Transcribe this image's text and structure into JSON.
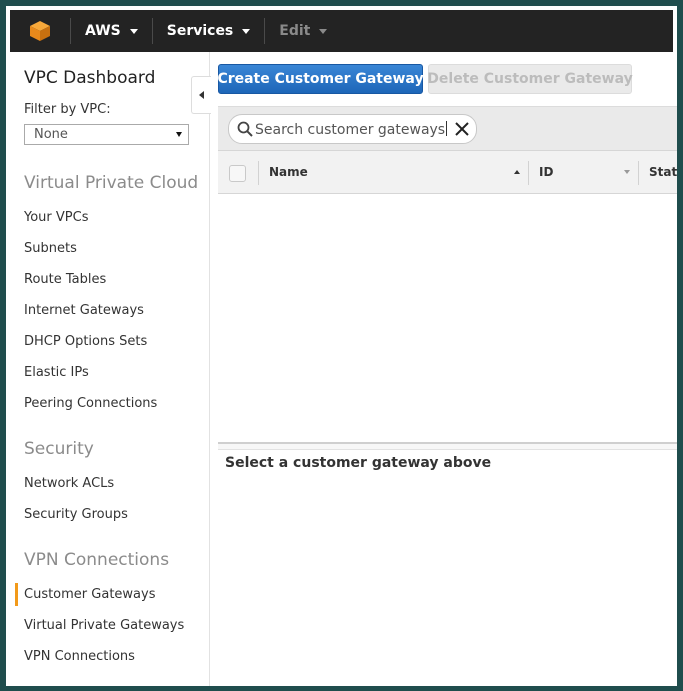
{
  "colors": {
    "nav_bg": "#232323",
    "primary": "#2a74c6",
    "active_indicator": "#f29a1a",
    "section_heading": "#8b8b8b"
  },
  "topnav": {
    "logo_icon": "aws-cube-icon",
    "items": [
      {
        "label": "AWS",
        "has_dropdown": true
      },
      {
        "label": "Services",
        "has_dropdown": true
      },
      {
        "label": "Edit",
        "has_dropdown": true,
        "disabled": true
      }
    ]
  },
  "sidebar": {
    "title": "VPC Dashboard",
    "filter_label": "Filter by VPC:",
    "filter_value": "None",
    "sections": [
      {
        "heading": "Virtual Private Cloud",
        "items": [
          "Your VPCs",
          "Subnets",
          "Route Tables",
          "Internet Gateways",
          "DHCP Options Sets",
          "Elastic IPs",
          "Peering Connections"
        ]
      },
      {
        "heading": "Security",
        "items": [
          "Network ACLs",
          "Security Groups"
        ]
      },
      {
        "heading": "VPN Connections",
        "items": [
          "Customer Gateways",
          "Virtual Private Gateways",
          "VPN Connections"
        ]
      }
    ],
    "active_item": "Customer Gateways"
  },
  "toolbar": {
    "create_label": "Create Customer Gateway",
    "delete_label": "Delete Customer Gateway"
  },
  "search": {
    "value": "Search customer gateways"
  },
  "table": {
    "columns": [
      {
        "label": "Name",
        "sort": "ascending"
      },
      {
        "label": "ID",
        "sort": "none"
      },
      {
        "label": "State",
        "sort": "none"
      }
    ],
    "rows": []
  },
  "details": {
    "message": "Select a customer gateway above"
  }
}
